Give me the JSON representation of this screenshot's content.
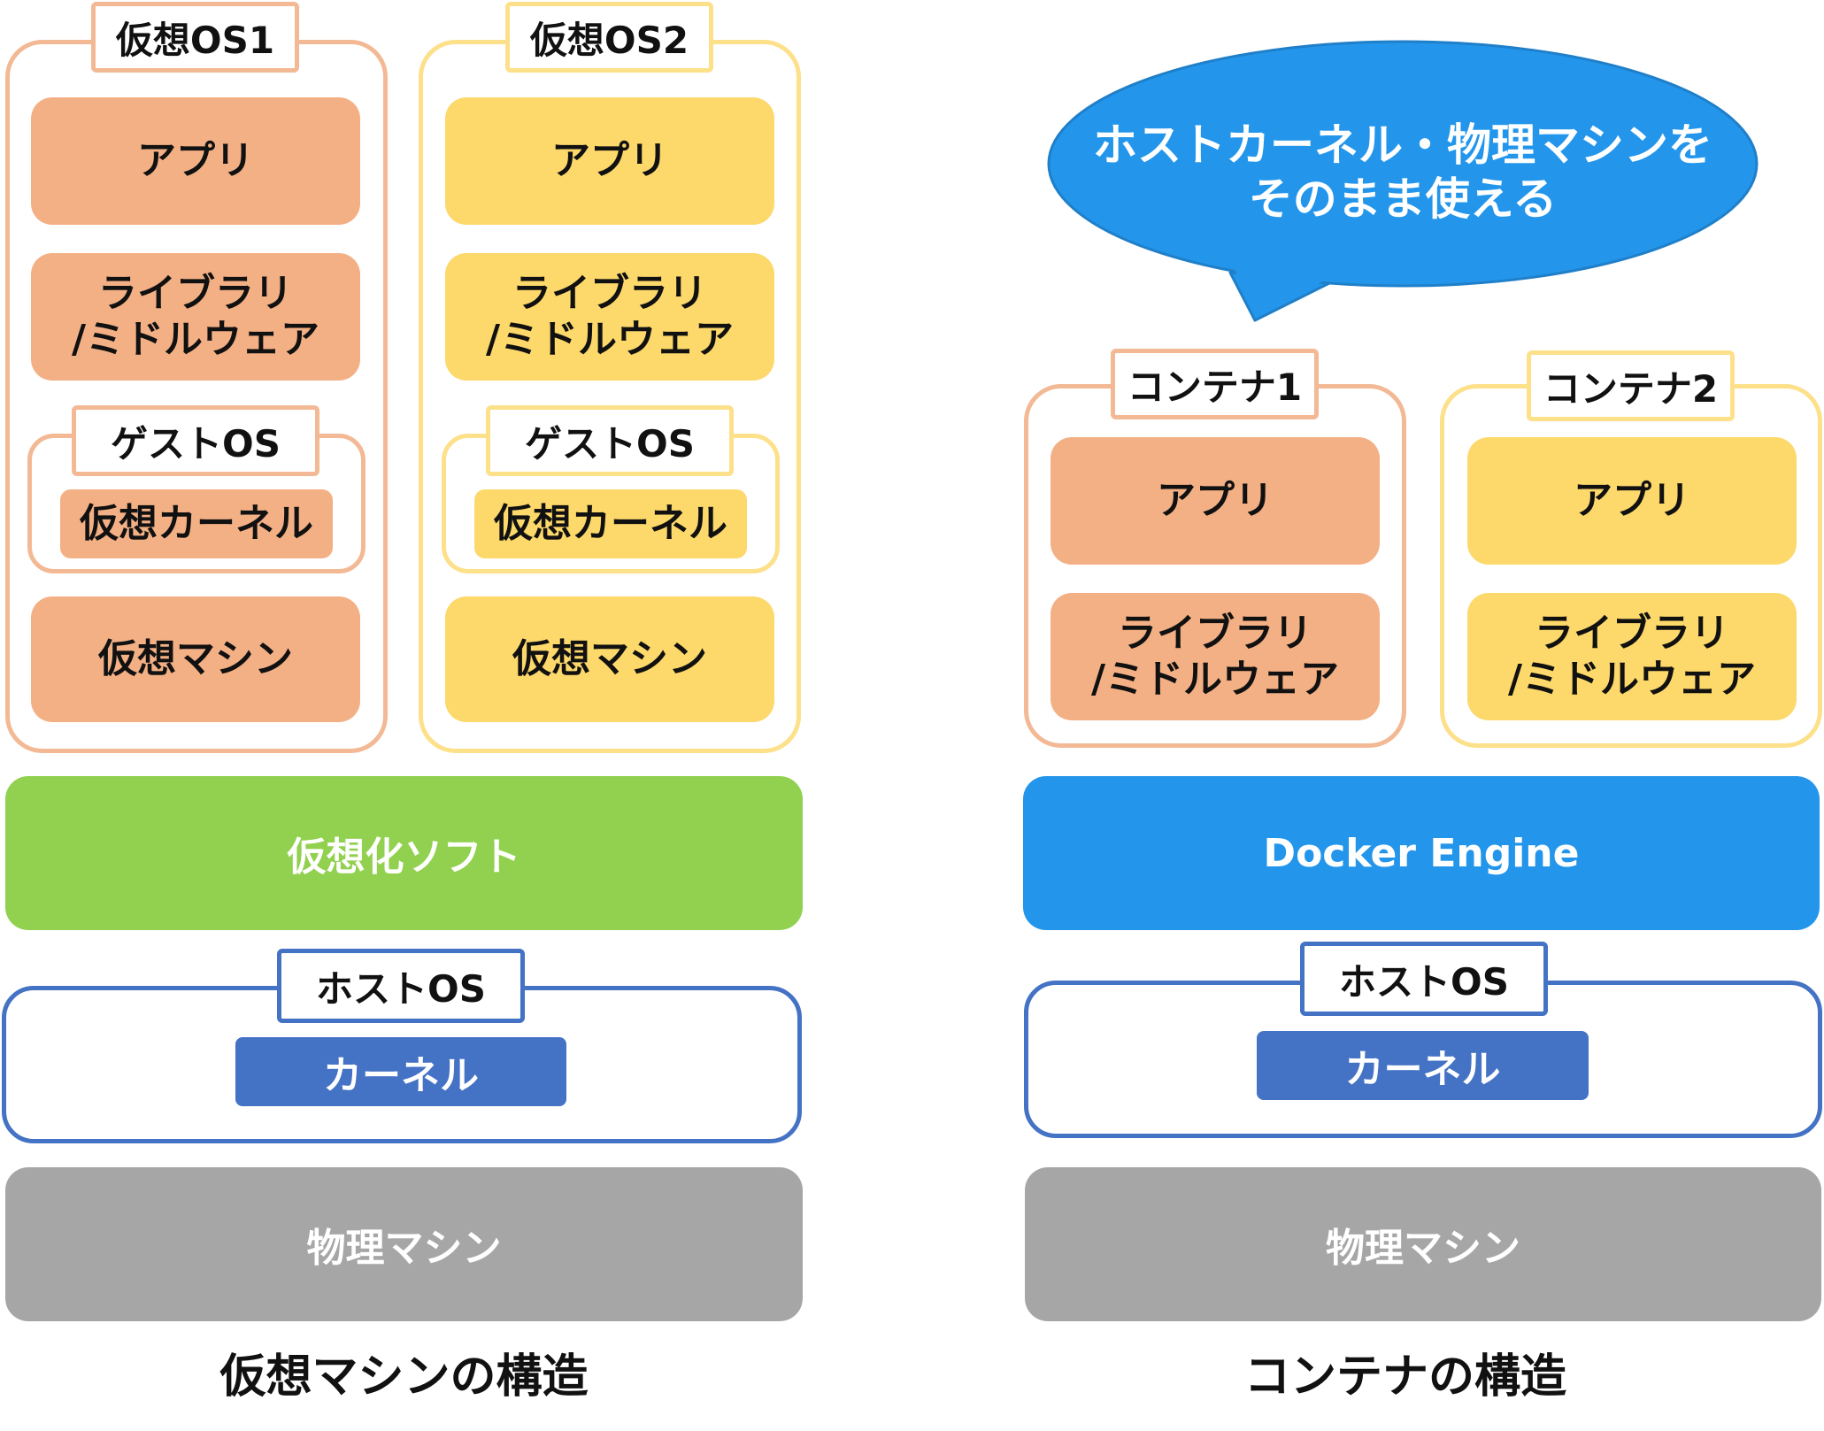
{
  "vm": {
    "guests": [
      {
        "title": "仮想OS1",
        "app": "アプリ",
        "lib": "ライブラリ\n/ミドルウェア",
        "guest_os": "ゲストOS",
        "vkernel": "仮想カーネル",
        "vmachine": "仮想マシン"
      },
      {
        "title": "仮想OS2",
        "app": "アプリ",
        "lib": "ライブラリ\n/ミドルウェア",
        "guest_os": "ゲストOS",
        "vkernel": "仮想カーネル",
        "vmachine": "仮想マシン"
      }
    ],
    "hypervisor": "仮想化ソフト",
    "host_os": "ホストOS",
    "kernel": "カーネル",
    "physical": "物理マシン",
    "caption": "仮想マシンの構造"
  },
  "container": {
    "bubble": "ホストカーネル・物理マシンを\nそのまま使える",
    "containers": [
      {
        "title": "コンテナ1",
        "app": "アプリ",
        "lib": "ライブラリ\n/ミドルウェア"
      },
      {
        "title": "コンテナ2",
        "app": "アプリ",
        "lib": "ライブラリ\n/ミドルウェア"
      }
    ],
    "engine": "Docker Engine",
    "host_os": "ホストOS",
    "kernel": "カーネル",
    "physical": "物理マシン",
    "caption": "コンテナの構造"
  },
  "colors": {
    "orange_fill": "#f4b085",
    "yellow_fill": "#fdd86a",
    "green": "#92d050",
    "blue": "#2396eb",
    "kernel_blue": "#4472c4",
    "gray": "#a6a6a6"
  }
}
